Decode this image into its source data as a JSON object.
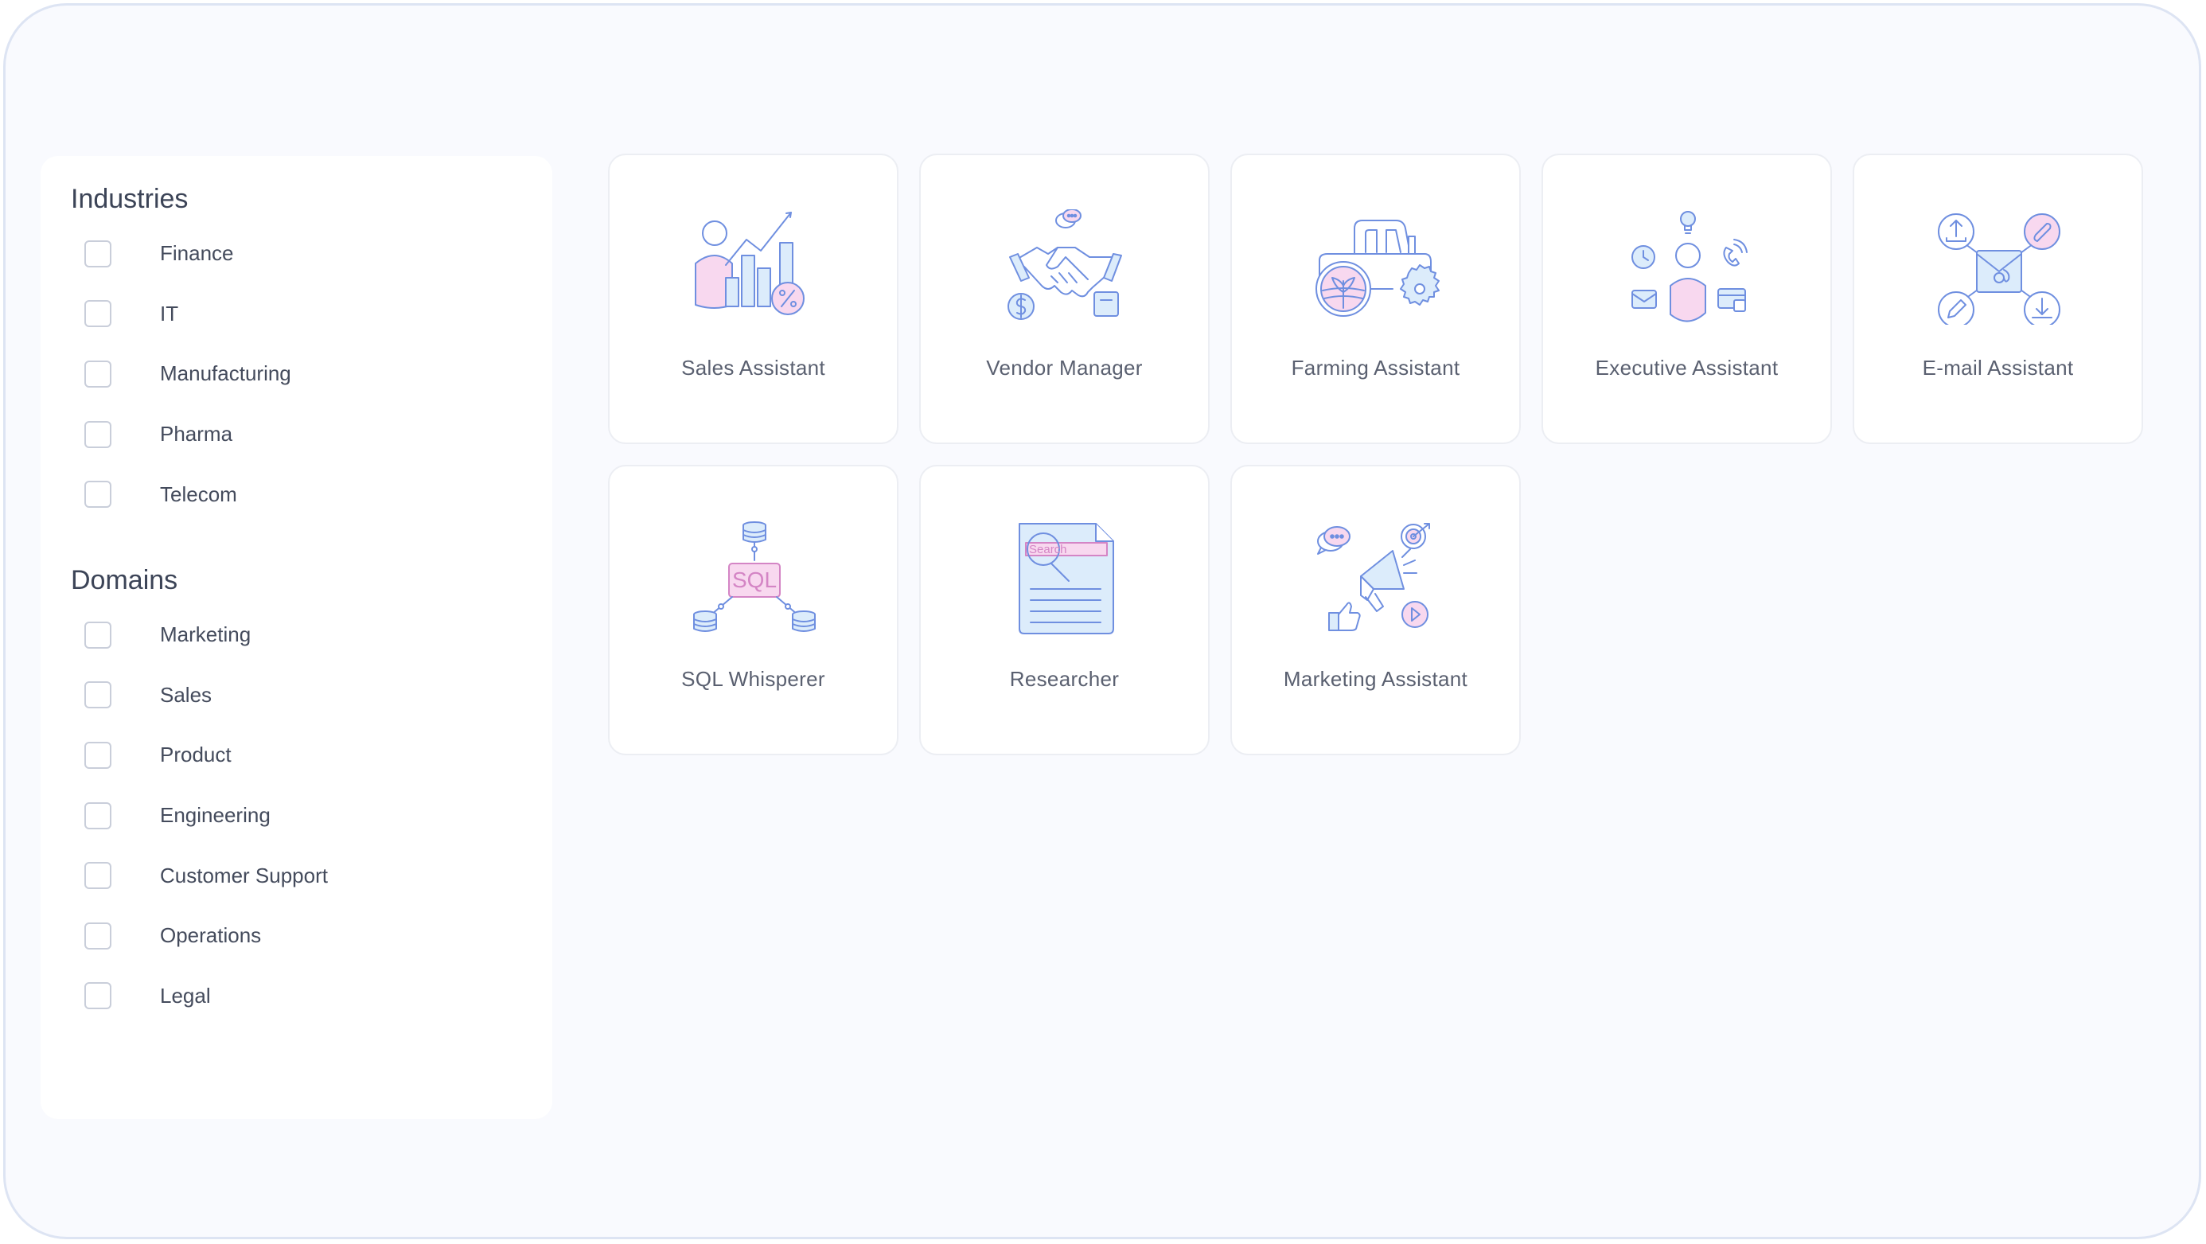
{
  "filters": {
    "industries": {
      "title": "Industries",
      "options": [
        {
          "label": "Finance"
        },
        {
          "label": "IT"
        },
        {
          "label": "Manufacturing"
        },
        {
          "label": "Pharma"
        },
        {
          "label": "Telecom"
        }
      ]
    },
    "domains": {
      "title": "Domains",
      "options": [
        {
          "label": "Marketing"
        },
        {
          "label": "Sales"
        },
        {
          "label": "Product"
        },
        {
          "label": "Engineering"
        },
        {
          "label": "Customer Support"
        },
        {
          "label": "Operations"
        },
        {
          "label": "Legal"
        }
      ]
    }
  },
  "assistants": [
    {
      "title": "Sales Assistant",
      "icon": "sales-chart-icon"
    },
    {
      "title": "Vendor Manager",
      "icon": "handshake-icon"
    },
    {
      "title": "Farming Assistant",
      "icon": "tractor-icon"
    },
    {
      "title": "Executive Assistant",
      "icon": "executive-icon"
    },
    {
      "title": "E-mail Assistant",
      "icon": "email-icon"
    },
    {
      "title": "SQL Whisperer",
      "icon": "sql-database-icon",
      "icon_text": "SQL"
    },
    {
      "title": "Researcher",
      "icon": "search-document-icon",
      "icon_text": "Search"
    },
    {
      "title": "Marketing Assistant",
      "icon": "megaphone-icon"
    }
  ],
  "colors": {
    "icon_stroke": "#6f8fe0",
    "icon_fill_blue": "#dcecfb",
    "icon_fill_pink": "#f8d8ef",
    "pink_text": "#d485c5"
  }
}
